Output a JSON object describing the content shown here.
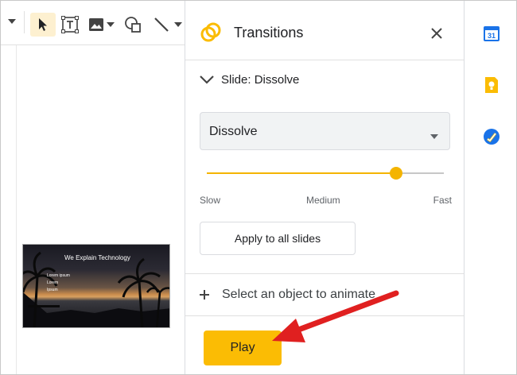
{
  "toolbar": {
    "icons": [
      "chevron-down-icon",
      "cursor-icon",
      "text-box-icon",
      "image-icon",
      "shape-icon",
      "line-icon"
    ]
  },
  "slide_thumbnail": {
    "title": "We Explain Technology",
    "lines": [
      "Lorem ipsum",
      "Lorem",
      "Ipsum"
    ]
  },
  "panel": {
    "title": "Transitions",
    "section_title": "Slide: Dissolve",
    "transition_type": "Dissolve",
    "speed": {
      "label_slow": "Slow",
      "label_medium": "Medium",
      "label_fast": "Fast",
      "value": 0.8
    },
    "apply_label": "Apply to all slides",
    "animate_label": "Select an object to animate",
    "play_label": "Play"
  },
  "rail": {
    "icons": [
      "calendar-icon",
      "keep-icon",
      "tasks-icon"
    ],
    "calendar_day": "31"
  },
  "colors": {
    "accent": "#fbbc04",
    "slider": "#f4b400",
    "annotation_arrow": "#e02020"
  }
}
